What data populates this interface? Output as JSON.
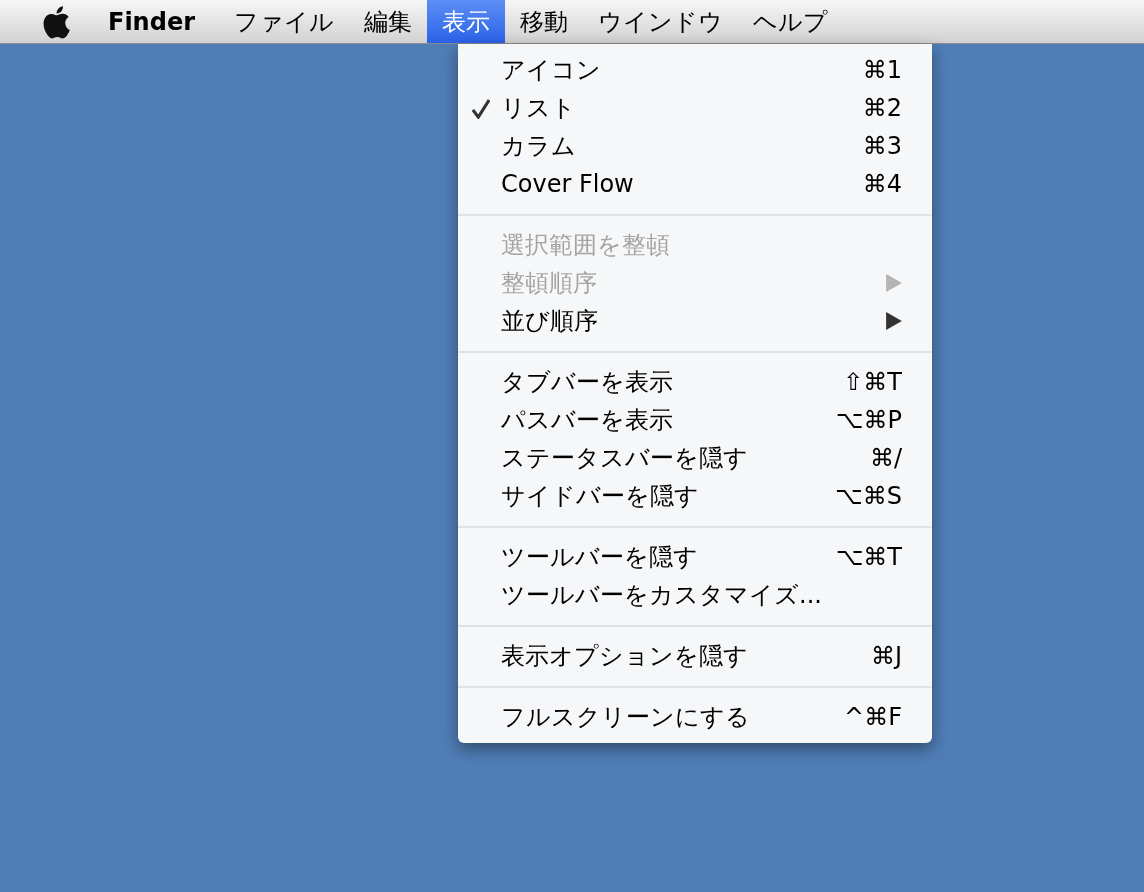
{
  "menu_bar": {
    "app_name": "Finder",
    "menus": [
      {
        "label": "ファイル",
        "selected": false
      },
      {
        "label": "編集",
        "selected": false
      },
      {
        "label": "表示",
        "selected": true
      },
      {
        "label": "移動",
        "selected": false
      },
      {
        "label": "ウインドウ",
        "selected": false
      },
      {
        "label": "ヘルプ",
        "selected": false
      }
    ]
  },
  "dropdown": {
    "groups": [
      {
        "items": [
          {
            "label": "アイコン",
            "shortcut": "⌘1",
            "checked": false,
            "disabled": false,
            "submenu": false
          },
          {
            "label": "リスト",
            "shortcut": "⌘2",
            "checked": true,
            "disabled": false,
            "submenu": false
          },
          {
            "label": "カラム",
            "shortcut": "⌘3",
            "checked": false,
            "disabled": false,
            "submenu": false
          },
          {
            "label": "Cover Flow",
            "shortcut": "⌘4",
            "checked": false,
            "disabled": false,
            "submenu": false
          }
        ]
      },
      {
        "items": [
          {
            "label": "選択範囲を整頓",
            "checked": false,
            "disabled": true,
            "submenu": false
          },
          {
            "label": "整頓順序",
            "checked": false,
            "disabled": true,
            "submenu": true
          },
          {
            "label": "並び順序",
            "checked": false,
            "disabled": false,
            "submenu": true
          }
        ]
      },
      {
        "items": [
          {
            "label": "タブバーを表示",
            "shortcut": "⇧⌘T",
            "checked": false,
            "disabled": false,
            "submenu": false
          },
          {
            "label": "パスバーを表示",
            "shortcut": "⌥⌘P",
            "checked": false,
            "disabled": false,
            "submenu": false
          },
          {
            "label": "ステータスバーを隠す",
            "shortcut": "⌘/",
            "checked": false,
            "disabled": false,
            "submenu": false
          },
          {
            "label": "サイドバーを隠す",
            "shortcut": "⌥⌘S",
            "checked": false,
            "disabled": false,
            "submenu": false
          }
        ]
      },
      {
        "items": [
          {
            "label": "ツールバーを隠す",
            "shortcut": "⌥⌘T",
            "checked": false,
            "disabled": false,
            "submenu": false
          },
          {
            "label": "ツールバーをカスタマイズ...",
            "checked": false,
            "disabled": false,
            "submenu": false
          }
        ]
      },
      {
        "items": [
          {
            "label": "表示オプションを隠す",
            "shortcut": "⌘J",
            "checked": false,
            "disabled": false,
            "submenu": false
          }
        ]
      },
      {
        "items": [
          {
            "label": "フルスクリーンにする",
            "shortcut": "^⌘F",
            "checked": false,
            "disabled": false,
            "submenu": false
          }
        ]
      }
    ]
  }
}
